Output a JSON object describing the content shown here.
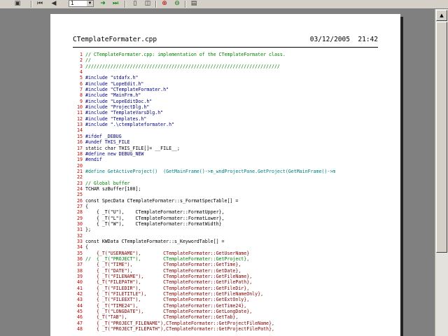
{
  "toolbar": {
    "buttons": [
      {
        "name": "print-icon",
        "glyph": "▣"
      },
      {
        "name": "first-page-icon",
        "glyph": "⏮"
      },
      {
        "name": "prev-page-icon",
        "glyph": "◀"
      },
      {
        "name": "next-page-icon",
        "glyph": "➜"
      },
      {
        "name": "last-page-icon",
        "glyph": "⏭"
      },
      {
        "name": "one-page-icon",
        "glyph": "▯"
      },
      {
        "name": "two-page-icon",
        "glyph": "◫"
      },
      {
        "name": "zoom-in-icon",
        "glyph": "⊕"
      },
      {
        "name": "zoom-out-icon",
        "glyph": "⊖"
      },
      {
        "name": "close-preview-icon",
        "glyph": "▤"
      }
    ],
    "page_number": "1",
    "combo_arrow": "▼"
  },
  "page": {
    "filename": "CTemplateFormater.cpp",
    "date": "03/12/2005  21:42"
  },
  "code_lines": [
    {
      "n": "1",
      "text": "// CTemplateFormater.cpp: implementation of the CTemplateFormater class.",
      "kind": "c"
    },
    {
      "n": "2",
      "text": "//",
      "kind": "c"
    },
    {
      "n": "3",
      "text": "//////////////////////////////////////////////////////////////////////",
      "kind": "c"
    },
    {
      "n": "4",
      "text": "",
      "kind": "t"
    },
    {
      "n": "5",
      "text": "#include \"stdafx.h\"",
      "kind": "p"
    },
    {
      "n": "6",
      "text": "#include \"LopeEdit.h\"",
      "kind": "p"
    },
    {
      "n": "7",
      "text": "#include \"CTemplateFormater.h\"",
      "kind": "p"
    },
    {
      "n": "8",
      "text": "#include \"MainFrm.h\"",
      "kind": "p"
    },
    {
      "n": "9",
      "text": "#include \"LopeEditDoc.h\"",
      "kind": "p"
    },
    {
      "n": "10",
      "text": "#include \"ProjectDlg.h\"",
      "kind": "p"
    },
    {
      "n": "11",
      "text": "#include \"TemplateVarsDlg.h\"",
      "kind": "p"
    },
    {
      "n": "12",
      "text": "#include \"Templates.h\"",
      "kind": "p"
    },
    {
      "n": "13",
      "text": "#include \".\\ctemplateformater.h\"",
      "kind": "p"
    },
    {
      "n": "14",
      "text": "",
      "kind": "t"
    },
    {
      "n": "15",
      "text": "#ifdef _DEBUG",
      "kind": "p"
    },
    {
      "n": "16",
      "text": "#undef THIS_FILE",
      "kind": "p"
    },
    {
      "n": "17",
      "text": "static char THIS_FILE[]= __FILE__;",
      "kind": "t"
    },
    {
      "n": "18",
      "text": "#define new DEBUG_NEW",
      "kind": "p"
    },
    {
      "n": "19",
      "text": "#endif",
      "kind": "p"
    },
    {
      "n": "20",
      "text": "",
      "kind": "t"
    },
    {
      "n": "21",
      "text": "#define GetActiveProject()  (GetMainFrame()->m_wndProjectPane.GetProject(GetMainFrame()->m",
      "kind": "d"
    },
    {
      "n": "22",
      "text": "",
      "kind": "t"
    },
    {
      "n": "23",
      "text": "// Global buffer",
      "kind": "c"
    },
    {
      "n": "24",
      "text": "TCHAR szBuffer[100];",
      "kind": "t"
    },
    {
      "n": "25",
      "text": "",
      "kind": "t"
    },
    {
      "n": "26",
      "text": "const SpecData CTemplateFormater::s_FormatSpecTable[] =",
      "kind": "t"
    },
    {
      "n": "27",
      "text": "{",
      "kind": "t"
    },
    {
      "n": "28",
      "text": "    { _T(\"U\"),    CTemplateFormater::FormatUpper},",
      "kind": "t"
    },
    {
      "n": "29",
      "text": "    { _T(\"L\"),    CTemplateFormater::FormatLower},",
      "kind": "t"
    },
    {
      "n": "30",
      "text": "    { _T(\"W\"),    CTemplateFormater::FormatWidth}",
      "kind": "t"
    },
    {
      "n": "31",
      "text": "};",
      "kind": "t"
    },
    {
      "n": "32",
      "text": "",
      "kind": "t"
    },
    {
      "n": "33",
      "text": "const KWData CTemplateFormater::s_KeywordTable[] =",
      "kind": "t"
    },
    {
      "n": "34",
      "text": "{",
      "kind": "t"
    },
    {
      "n": "35",
      "text": "    {_T(\"USERNAME\"),        CTemplateFormater::GetUserName}",
      "kind": "s"
    },
    {
      "n": "36",
      "text": "//  { _T(\"PROJECT\"),        CTemplateFormater::GetProject},",
      "kind": "c"
    },
    {
      "n": "37",
      "text": "    { _T(\"TIME\"),           CTemplateFormater::GetTime},",
      "kind": "s"
    },
    {
      "n": "38",
      "text": "    { _T(\"DATE\"),           CTemplateFormater::GetDate},",
      "kind": "s"
    },
    {
      "n": "39",
      "text": "    { _T(\"FILENAME\"),       CTemplateFormater::GetFileName},",
      "kind": "s"
    },
    {
      "n": "40",
      "text": "    {_T(\"FILEPATH\"),        CTemplateFormater::GetFilePath},",
      "kind": "s"
    },
    {
      "n": "41",
      "text": "    { _T(\"FILEDIR\"),        CTemplateFormater::GetFileDir},",
      "kind": "s"
    },
    {
      "n": "42",
      "text": "    { _T(\"FILETITLE\"),      CTemplateFormater::GetFileNameOnly},",
      "kind": "s"
    },
    {
      "n": "43",
      "text": "    { _T(\"FILEEXT\"),        CTemplateFormater::GetExtOnly},",
      "kind": "s"
    },
    {
      "n": "44",
      "text": "    { _T(\"TIME24\"),         CTemplateFormater::GetTime24},",
      "kind": "s"
    },
    {
      "n": "45",
      "text": "    { _T(\"LONGDATE\"),       CTemplateFormater::GetLongDate},",
      "kind": "s"
    },
    {
      "n": "46",
      "text": "    {_T(\"TAB\"),             CTemplateFormater::GetTab},",
      "kind": "s"
    },
    {
      "n": "47",
      "text": "    { _T(\"PROJECT_FILENAME\"),CTemplateFormater::GetProjectFileName},",
      "kind": "s"
    },
    {
      "n": "48",
      "text": "    { _T(\"PROJECT_FILEPATH\"),CTemplateFormater::GetProjectFilePath},",
      "kind": "s"
    }
  ],
  "scrollbar": {
    "up_arrow": "▲"
  }
}
